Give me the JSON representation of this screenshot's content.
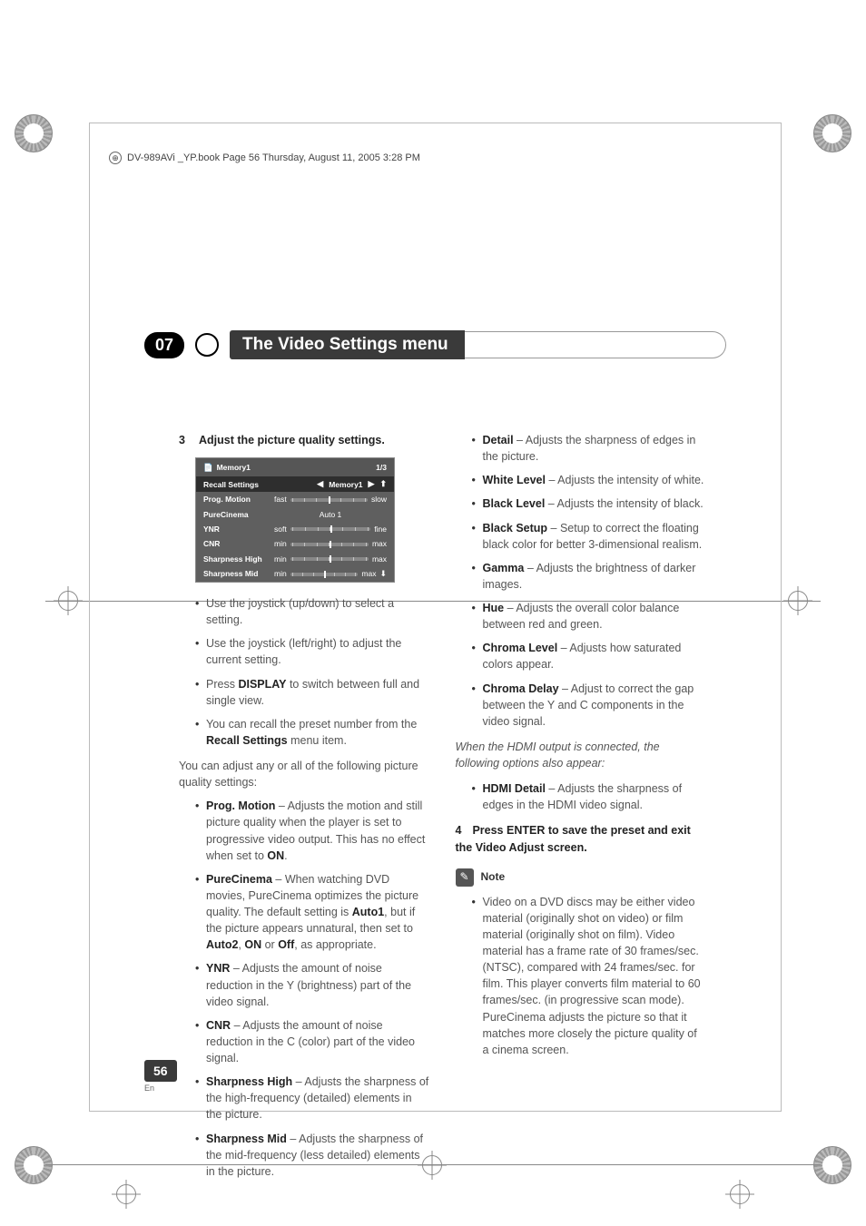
{
  "crop": {
    "bookline": "DV-989AVi _YP.book  Page 56  Thursday, August 11, 2005  3:28 PM"
  },
  "header": {
    "chapter_num": "07",
    "chapter_title": "The Video Settings menu"
  },
  "osd": {
    "title": "Memory1",
    "page": "1/3",
    "header_row_label": "Recall Settings",
    "header_row_value": "Memory1",
    "rows": [
      {
        "label": "Prog. Motion",
        "left": "fast",
        "right": "slow"
      },
      {
        "label": "PureCinema",
        "center": "Auto 1"
      },
      {
        "label": "YNR",
        "left": "soft",
        "right": "fine"
      },
      {
        "label": "CNR",
        "left": "min",
        "right": "max"
      },
      {
        "label": "Sharpness High",
        "left": "min",
        "right": "max"
      },
      {
        "label": "Sharpness Mid",
        "left": "min",
        "right": "max"
      }
    ]
  },
  "left": {
    "step3": {
      "num": "3",
      "label": "Adjust the picture quality settings."
    },
    "tips": [
      "Use the joystick (up/down) to select a setting.",
      "Use the joystick (left/right) to adjust the current setting.",
      {
        "pre": "Press ",
        "bold": "DISPLAY",
        "post": " to switch between full and single view."
      },
      {
        "pre": "You can recall the preset number from the ",
        "bold": "Recall Settings",
        "post": " menu item."
      }
    ],
    "intro": "You can adjust any or all of the following picture quality settings:",
    "settings": [
      {
        "name": "Prog. Motion",
        "desc_pre": " – Adjusts the motion and still picture quality when the player is set to progressive video output. This has no effect when set to ",
        "b1": "ON",
        "desc_post": "."
      },
      {
        "name": "PureCinema",
        "desc_pre": " – When watching DVD movies, PureCinema optimizes the picture quality. The default setting is ",
        "b1": "Auto1",
        "mid": ", but if the picture appears unnatural, then set to ",
        "b2": "Auto2",
        "sep1": ", ",
        "b3": "ON",
        "sep2": " or ",
        "b4": "Off",
        "desc_post": ", as appropriate."
      },
      {
        "name": "YNR",
        "desc": " – Adjusts the amount of noise reduction in the Y (brightness) part of the video signal."
      },
      {
        "name": "CNR",
        "desc": " – Adjusts the amount of noise reduction in the C (color) part of the video signal."
      },
      {
        "name": "Sharpness High",
        "desc": " – Adjusts the sharpness of the high-frequency (detailed) elements in the picture."
      },
      {
        "name": "Sharpness Mid",
        "desc": " – Adjusts the sharpness of the mid-frequency (less detailed) elements in the picture."
      }
    ]
  },
  "right": {
    "settings": [
      {
        "name": "Detail",
        "desc": " – Adjusts the sharpness of edges in the picture."
      },
      {
        "name": "White Level",
        "desc": " – Adjusts the intensity of white."
      },
      {
        "name": "Black Level",
        "desc": " – Adjusts the intensity of black."
      },
      {
        "name": "Black Setup",
        "desc": " – Setup to correct the floating black color for better 3-dimensional realism."
      },
      {
        "name": "Gamma",
        "desc": " – Adjusts the brightness of darker images."
      },
      {
        "name": "Hue",
        "desc": " – Adjusts the overall color balance between red and green."
      },
      {
        "name": "Chroma Level",
        "desc": " – Adjusts how saturated colors appear."
      },
      {
        "name": "Chroma Delay",
        "desc": " – Adjust to correct the gap between the Y and C components in the video signal."
      }
    ],
    "hdmi_intro": "When the HDMI output is connected, the following options also appear:",
    "hdmi": {
      "name": "HDMI Detail",
      "desc": " – Adjusts the sharpness of edges in the HDMI video signal."
    },
    "step4": {
      "num": "4",
      "label": "Press ENTER to save the preset and exit the Video Adjust screen."
    },
    "note_label": "Note",
    "note_body": "Video on a DVD discs may be either video material (originally shot on video) or film material (originally shot on film). Video material has a frame rate of 30 frames/sec.(NTSC), compared with 24 frames/sec. for film. This player converts film material to 60 frames/sec. (in progressive scan mode). PureCinema adjusts the picture so that it matches more closely the picture quality of a cinema screen."
  },
  "footer": {
    "page": "56",
    "lang": "En"
  }
}
